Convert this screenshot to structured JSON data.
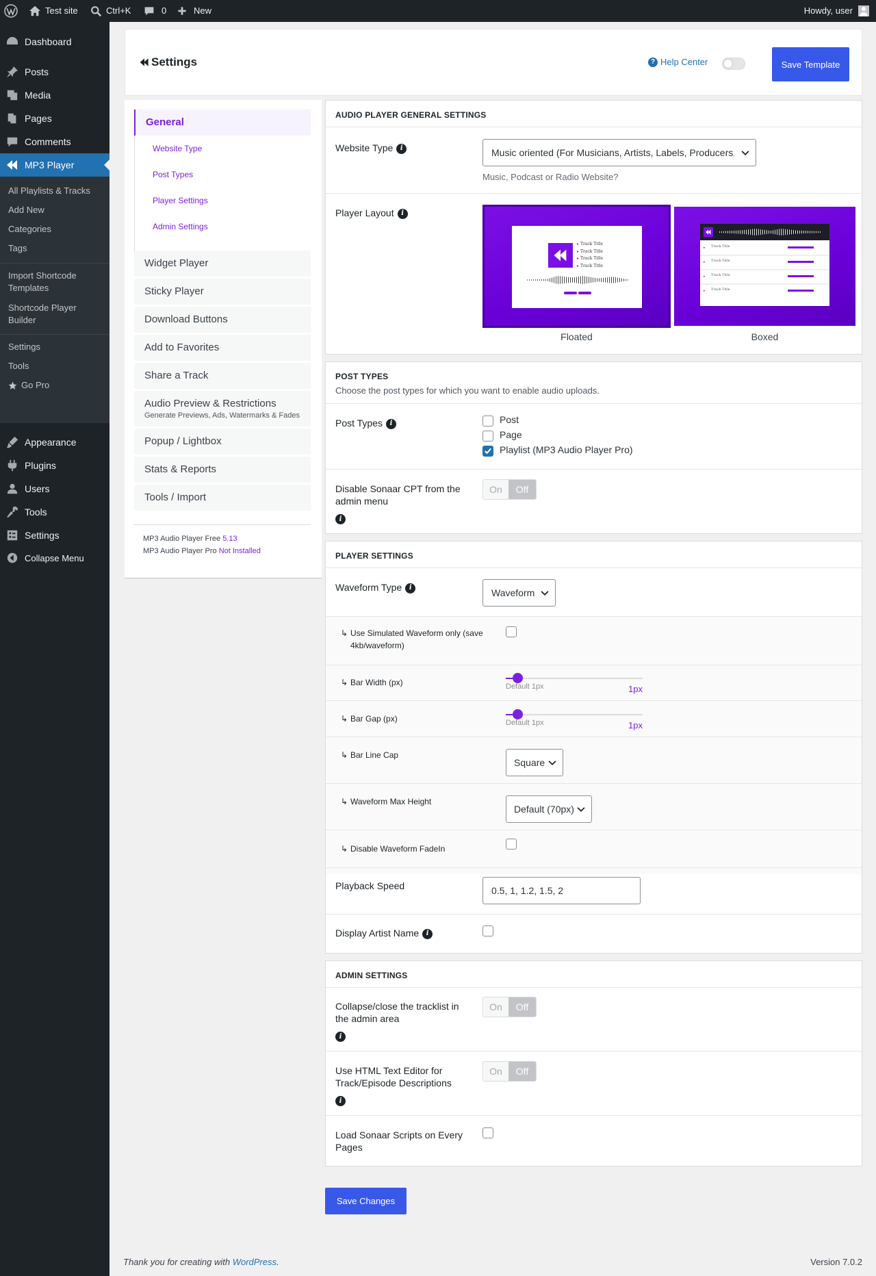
{
  "adminbar": {
    "site_name": "Test site",
    "search_shortcut": "Ctrl+K",
    "comments_count": "0",
    "new_label": "New",
    "greeting": "Howdy, user"
  },
  "sidebar": {
    "items": [
      {
        "label": "Dashboard",
        "icon": "dashboard-icon"
      },
      {
        "label": "Posts",
        "icon": "pin-icon"
      },
      {
        "label": "Media",
        "icon": "media-icon"
      },
      {
        "label": "Pages",
        "icon": "pages-icon"
      },
      {
        "label": "Comments",
        "icon": "comment-icon"
      },
      {
        "label": "MP3 Player",
        "icon": "sonaar-icon"
      }
    ],
    "submenu": [
      "All Playlists & Tracks",
      "Add New",
      "Categories",
      "Tags",
      "Import Shortcode Templates",
      "Shortcode Player Builder",
      "Settings",
      "Tools",
      "Go Pro"
    ],
    "items_bottom": [
      {
        "label": "Appearance",
        "icon": "appearance-icon"
      },
      {
        "label": "Plugins",
        "icon": "plugin-icon"
      },
      {
        "label": "Users",
        "icon": "users-icon"
      },
      {
        "label": "Tools",
        "icon": "wrench-icon"
      },
      {
        "label": "Settings",
        "icon": "settings-icon"
      },
      {
        "label": "Collapse Menu",
        "icon": "collapse-icon"
      }
    ]
  },
  "header": {
    "title": "Settings",
    "help_center": "Help Center",
    "save_template": "Save Template"
  },
  "leftnav": {
    "general": "General",
    "general_links": [
      "Website Type",
      "Post Types",
      "Player Settings",
      "Admin Settings"
    ],
    "items": [
      {
        "label": "Widget Player"
      },
      {
        "label": "Sticky Player"
      },
      {
        "label": "Download Buttons"
      },
      {
        "label": "Add to Favorites"
      },
      {
        "label": "Share a Track"
      },
      {
        "label": "Audio Preview & Restrictions",
        "sub": "Generate Previews, Ads, Watermarks & Fades"
      },
      {
        "label": "Popup / Lightbox"
      },
      {
        "label": "Stats & Reports"
      },
      {
        "label": "Tools / Import"
      }
    ],
    "free_label": "MP3 Audio Player Free",
    "free_version": "5.13",
    "pro_label": "MP3 Audio Player Pro",
    "pro_status": "Not Installed"
  },
  "general": {
    "title": "AUDIO PLAYER GENERAL SETTINGS",
    "website_type_label": "Website Type",
    "website_type_value": "Music oriented (For Musicians, Artists, Labels, Producers, etc)",
    "website_type_desc": "Music, Podcast or Radio Website?",
    "player_layout_label": "Player Layout",
    "layout_floated": "Floated",
    "layout_boxed": "Boxed",
    "track_title": "Track Title"
  },
  "post_types": {
    "title": "POST TYPES",
    "desc": "Choose the post types for which you want to enable audio uploads.",
    "label": "Post Types",
    "options": [
      {
        "label": "Post",
        "checked": false
      },
      {
        "label": "Page",
        "checked": false
      },
      {
        "label": "Playlist (MP3 Audio Player Pro)",
        "checked": true
      }
    ],
    "disable_cpt_label": "Disable Sonaar CPT from the admin menu",
    "toggle_on": "On",
    "toggle_off": "Off"
  },
  "player": {
    "title": "PLAYER SETTINGS",
    "waveform_type_label": "Waveform Type",
    "waveform_type_value": "Waveform",
    "simulated_label": "Use Simulated Waveform only (save 4kb/waveform)",
    "bar_width_label": "Bar Width (px)",
    "bar_width_default": "Default 1px",
    "bar_width_value": "1px",
    "bar_gap_label": "Bar Gap (px)",
    "bar_gap_default": "Default 1px",
    "bar_gap_value": "1px",
    "line_cap_label": "Bar Line Cap",
    "line_cap_value": "Square",
    "max_height_label": "Waveform Max Height",
    "max_height_value": "Default (70px)",
    "fadein_label": "Disable Waveform FadeIn",
    "playback_label": "Playback Speed",
    "playback_value": "0.5, 1, 1.2, 1.5, 2",
    "artist_label": "Display Artist Name"
  },
  "admin": {
    "title": "ADMIN SETTINGS",
    "collapse_label": "Collapse/close the tracklist in the admin area",
    "html_editor_label": "Use HTML Text Editor for Track/Episode Descriptions",
    "load_scripts_label": "Load Sonaar Scripts on Every Pages",
    "toggle_on": "On",
    "toggle_off": "Off"
  },
  "save_changes": "Save Changes",
  "footer": {
    "thanks_prefix": "Thank you for creating with ",
    "wordpress": "WordPress",
    "thanks_suffix": ".",
    "version": "Version 7.0.2"
  },
  "colors": {
    "accent": "#7b1fe0",
    "primary_button": "#3858e9",
    "admin_bar": "#1d2327",
    "active_menu": "#2271b1"
  }
}
